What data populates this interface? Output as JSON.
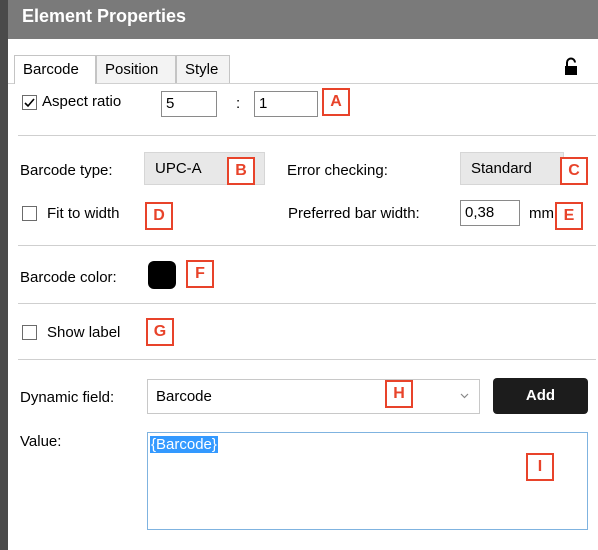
{
  "header": {
    "title": "Element Properties"
  },
  "tabs": [
    {
      "label": "Barcode",
      "active": true
    },
    {
      "label": "Position",
      "active": false
    },
    {
      "label": "Style",
      "active": false
    }
  ],
  "aspect_ratio": {
    "label": "Aspect ratio",
    "checked": true,
    "width_value": "5",
    "separator": ":",
    "height_value": "1"
  },
  "barcode_type": {
    "label": "Barcode type:",
    "value": "UPC-A"
  },
  "error_checking": {
    "label": "Error checking:",
    "value": "Standard"
  },
  "fit_to_width": {
    "label": "Fit to width",
    "checked": false
  },
  "preferred_bar_width": {
    "label": "Preferred bar width:",
    "value": "0,38",
    "unit": "mm"
  },
  "barcode_color": {
    "label": "Barcode color:",
    "color": "#000000"
  },
  "show_label": {
    "label": "Show label",
    "checked": false
  },
  "dynamic_field": {
    "label": "Dynamic field:",
    "value": "Barcode",
    "add_label": "Add"
  },
  "value_field": {
    "label": "Value:",
    "value": "{Barcode}"
  },
  "markers": [
    "A",
    "B",
    "C",
    "D",
    "E",
    "F",
    "G",
    "H",
    "I"
  ],
  "colors": {
    "marker": "#e8432a",
    "header": "#7a7a7a",
    "add_button": "#1c1c1c",
    "selection": "#3399ff"
  }
}
